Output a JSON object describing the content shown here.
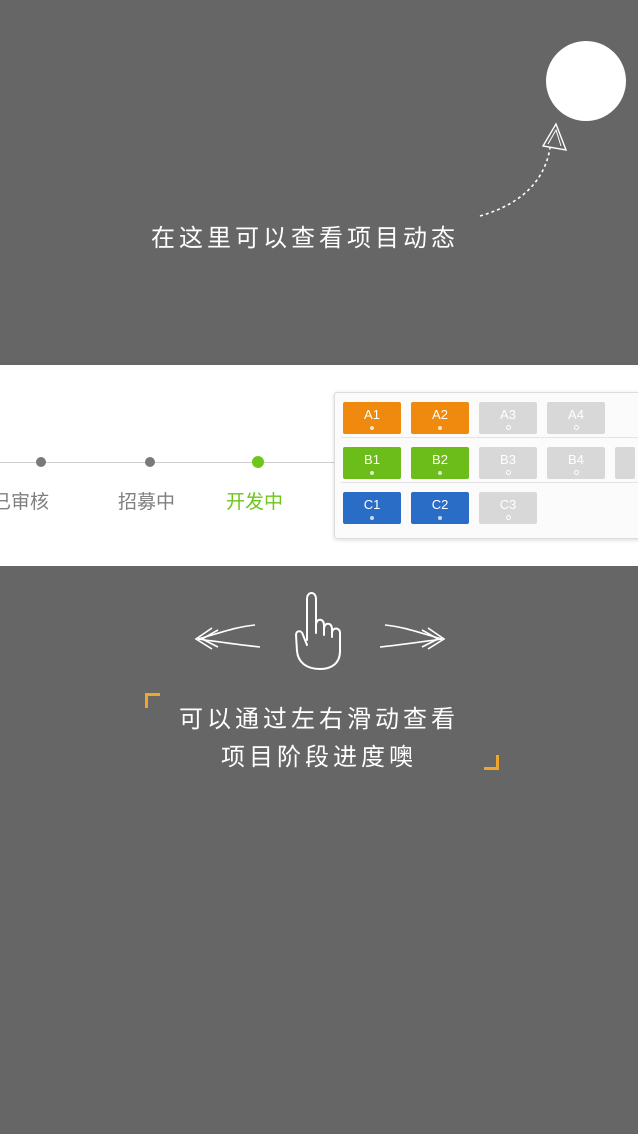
{
  "guide": {
    "top_hint": "在这里可以查看项目动态",
    "bottom_hint_line1": "可以通过左右滑动查看",
    "bottom_hint_line2": "项目阶段进度噢"
  },
  "timeline": {
    "stages": [
      {
        "label": "已审核",
        "active": false
      },
      {
        "label": "招募中",
        "active": false
      },
      {
        "label": "开发中",
        "active": true
      }
    ],
    "active_color": "#6ec61b"
  },
  "projects": {
    "rows": [
      [
        {
          "label": "A1",
          "color": "orange"
        },
        {
          "label": "A2",
          "color": "orange"
        },
        {
          "label": "A3",
          "color": "gray"
        },
        {
          "label": "A4",
          "color": "gray"
        }
      ],
      [
        {
          "label": "B1",
          "color": "green"
        },
        {
          "label": "B2",
          "color": "green"
        },
        {
          "label": "B3",
          "color": "gray"
        },
        {
          "label": "B4",
          "color": "gray"
        }
      ],
      [
        {
          "label": "C1",
          "color": "blue"
        },
        {
          "label": "C2",
          "color": "blue"
        },
        {
          "label": "C3",
          "color": "gray"
        }
      ]
    ],
    "colors": {
      "orange": "#f08a0e",
      "green": "#6cbd19",
      "blue": "#2a6dc7",
      "gray": "#d8d8d8"
    }
  },
  "icons": {
    "spotlight": "spotlight-circle-icon",
    "hand": "swipe-hand-icon",
    "arrow_left": "arrow-left-icon",
    "arrow_right": "arrow-right-icon",
    "arrow_up": "dashed-arrow-icon"
  }
}
